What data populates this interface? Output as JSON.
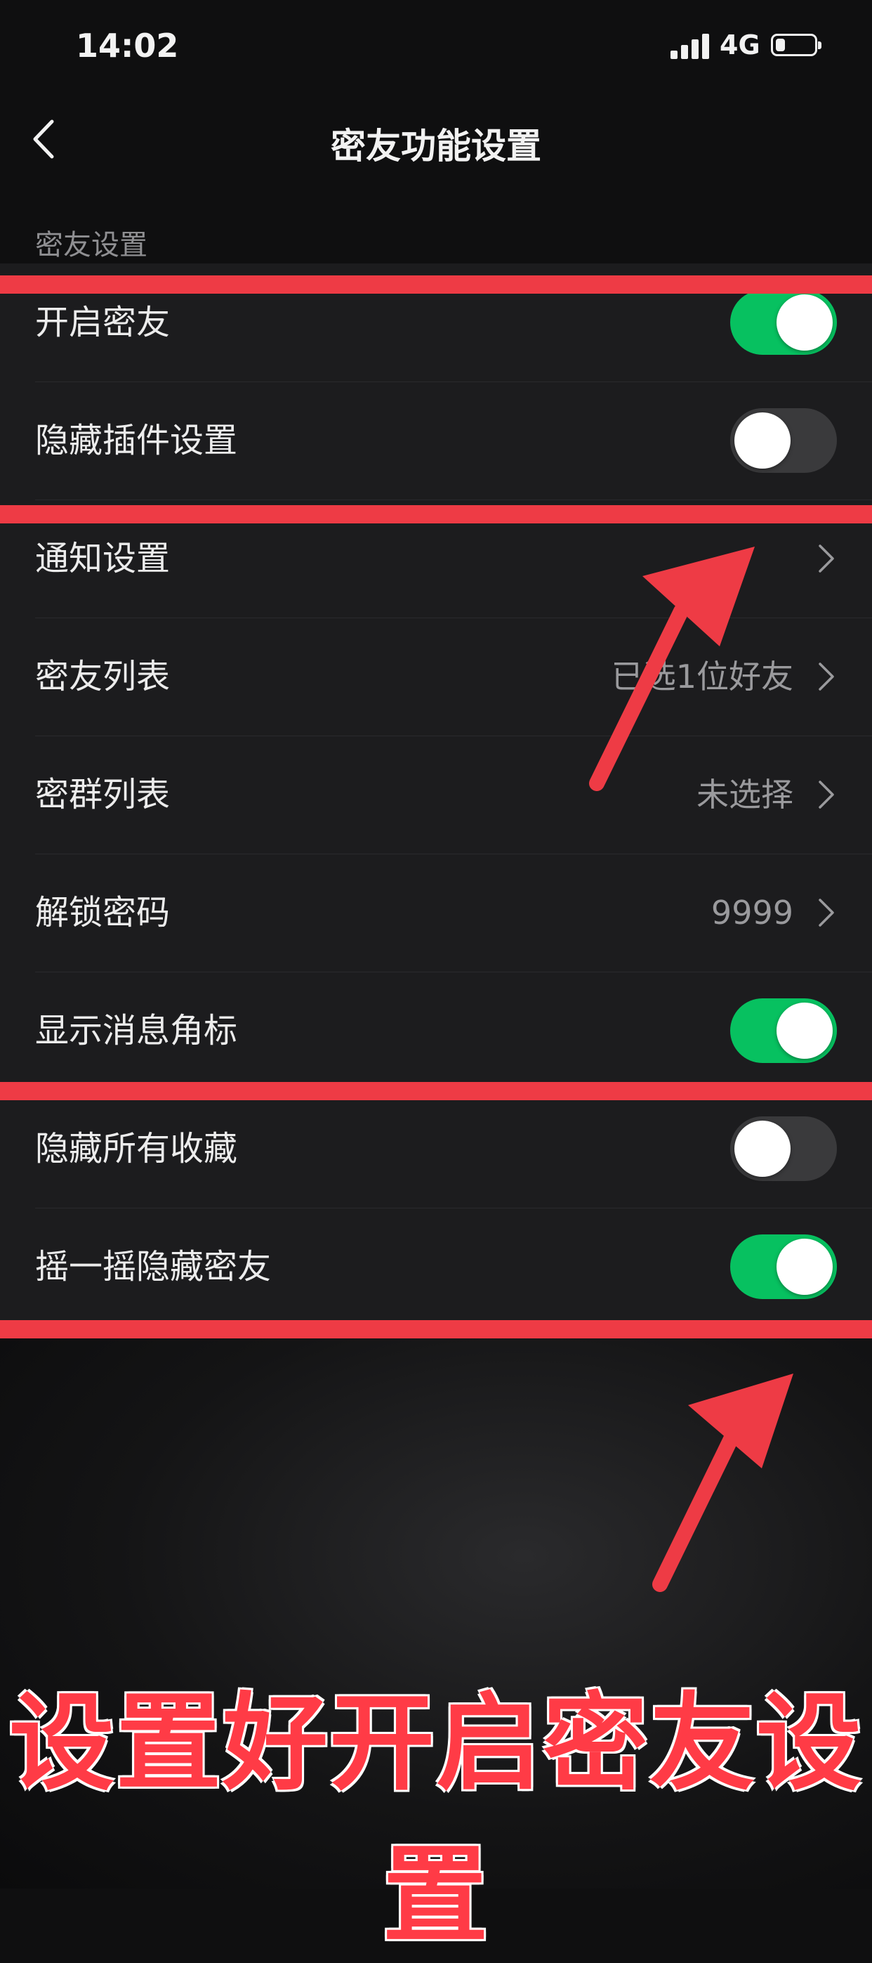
{
  "status_bar": {
    "time": "14:02",
    "network": "4G",
    "battery_level": 0.25
  },
  "nav": {
    "title": "密友功能设置",
    "back_icon": "chevron-left-icon"
  },
  "section": {
    "label": "密友设置"
  },
  "rows": [
    {
      "label": "开启密友",
      "type": "toggle",
      "on": true
    },
    {
      "label": "隐藏插件设置",
      "type": "toggle",
      "on": false
    },
    {
      "label": "通知设置",
      "type": "link",
      "value": ""
    },
    {
      "label": "密友列表",
      "type": "link",
      "value": "已选1位好友"
    },
    {
      "label": "密群列表",
      "type": "link",
      "value": "未选择"
    },
    {
      "label": "解锁密码",
      "type": "link",
      "value": "9999"
    },
    {
      "label": "显示消息角标",
      "type": "toggle",
      "on": true
    },
    {
      "label": "隐藏所有收藏",
      "type": "toggle",
      "on": false
    },
    {
      "label": "摇一摇隐藏密友",
      "type": "toggle",
      "on": true
    }
  ],
  "annotation": {
    "caption": "设置好开启密友设置",
    "color": "#ee3b45"
  },
  "colors": {
    "toggle_on": "#07c160",
    "toggle_off": "#3a3a3c",
    "row_bg": "#1c1c1e"
  }
}
